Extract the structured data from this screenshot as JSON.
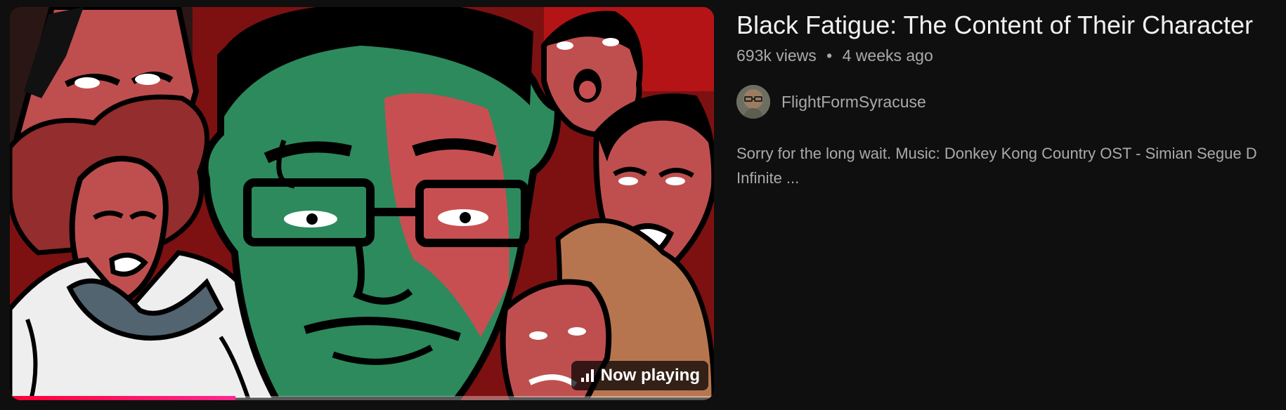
{
  "video": {
    "title": "Black Fatigue: The Content of Their Character",
    "views": "693k views",
    "separator": "•",
    "age": "4 weeks ago",
    "channel": "FlightFormSyracuse",
    "description_lines": [
      "Sorry for the long wait. Music: Donkey Kong Country OST - Simian Segue D",
      "Infinite ..."
    ],
    "now_playing_label": "Now playing",
    "watch_progress_fraction": 0.32
  },
  "icons": {
    "now_playing": "equalizer-bars-icon",
    "avatar": "channel-avatar-face"
  },
  "colors": {
    "background": "#0f0f0f",
    "title": "#f1f1f1",
    "secondary_text": "#aaaaaa",
    "progress_red": "#ff0033",
    "progress_pink": "#ff2791"
  }
}
